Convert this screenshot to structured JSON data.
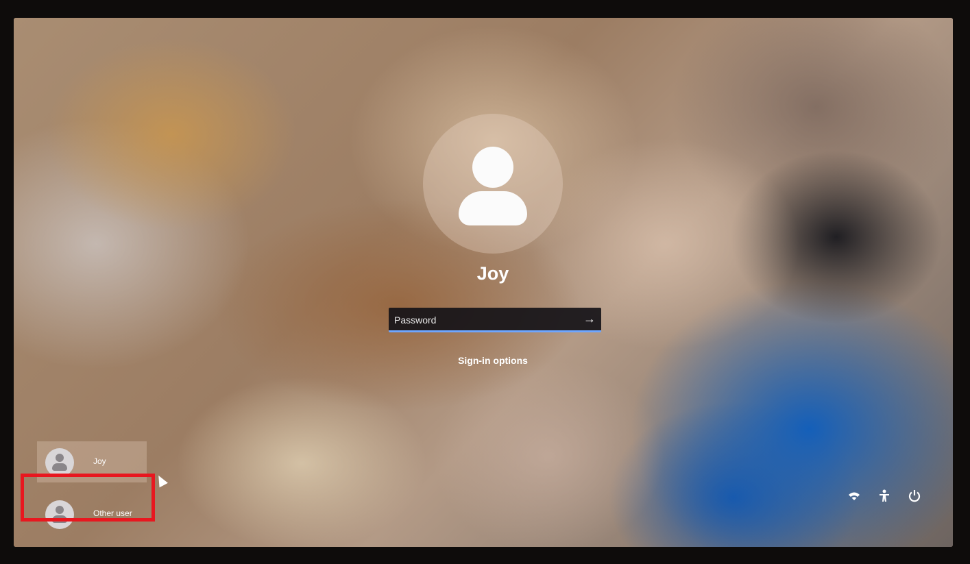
{
  "login": {
    "username": "Joy",
    "password_placeholder": "Password",
    "sign_in_options": "Sign-in options"
  },
  "users": [
    {
      "label": "Joy"
    },
    {
      "label": "Other user"
    }
  ],
  "system_icons": [
    "wifi-icon",
    "accessibility-icon",
    "power-icon"
  ],
  "colors": {
    "highlight": "#e8171f",
    "input_focus": "#6ea6ff"
  }
}
